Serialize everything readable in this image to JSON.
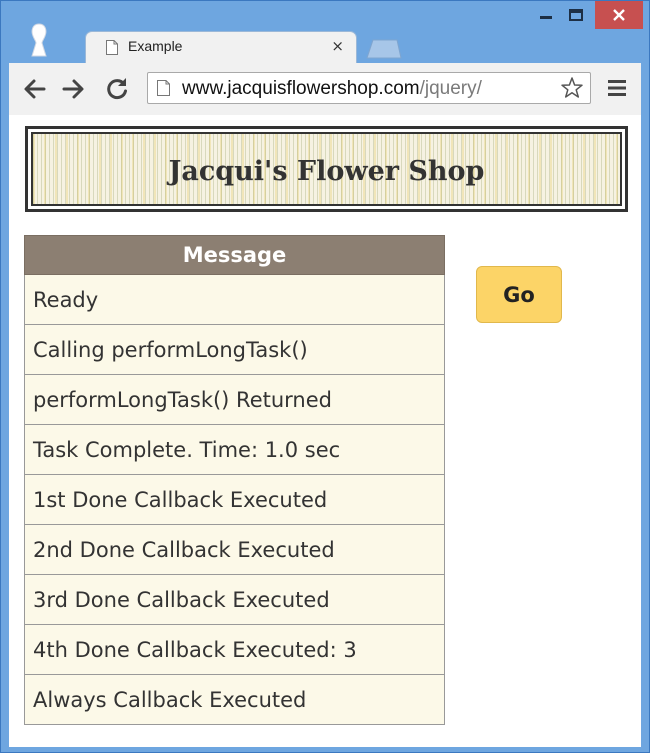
{
  "browser": {
    "tab_title": "Example",
    "tab_close_label": "×",
    "url_host": "www.jacquisflowershop.com",
    "url_path": "/jquery/",
    "close_color": "#c75050"
  },
  "page": {
    "banner_title": "Jacqui's Flower Shop",
    "table": {
      "header": "Message",
      "rows": [
        "Ready",
        "Calling performLongTask()",
        "performLongTask() Returned",
        "Task Complete. Time: 1.0 sec",
        "1st Done Callback Executed",
        "2nd Done Callback Executed",
        "3rd Done Callback Executed",
        "4th Done Callback Executed: 3",
        "Always Callback Executed"
      ]
    },
    "go_button_label": "Go",
    "colors": {
      "table_header": "#8c7f72",
      "table_cell": "#fcf9e8",
      "go_button": "#fcd467"
    }
  },
  "icons": [
    "user-icon",
    "page-icon",
    "close-icon",
    "back-arrow-icon",
    "forward-arrow-icon",
    "reload-icon",
    "star-icon",
    "menu-icon",
    "minimize-icon",
    "maximize-icon"
  ]
}
